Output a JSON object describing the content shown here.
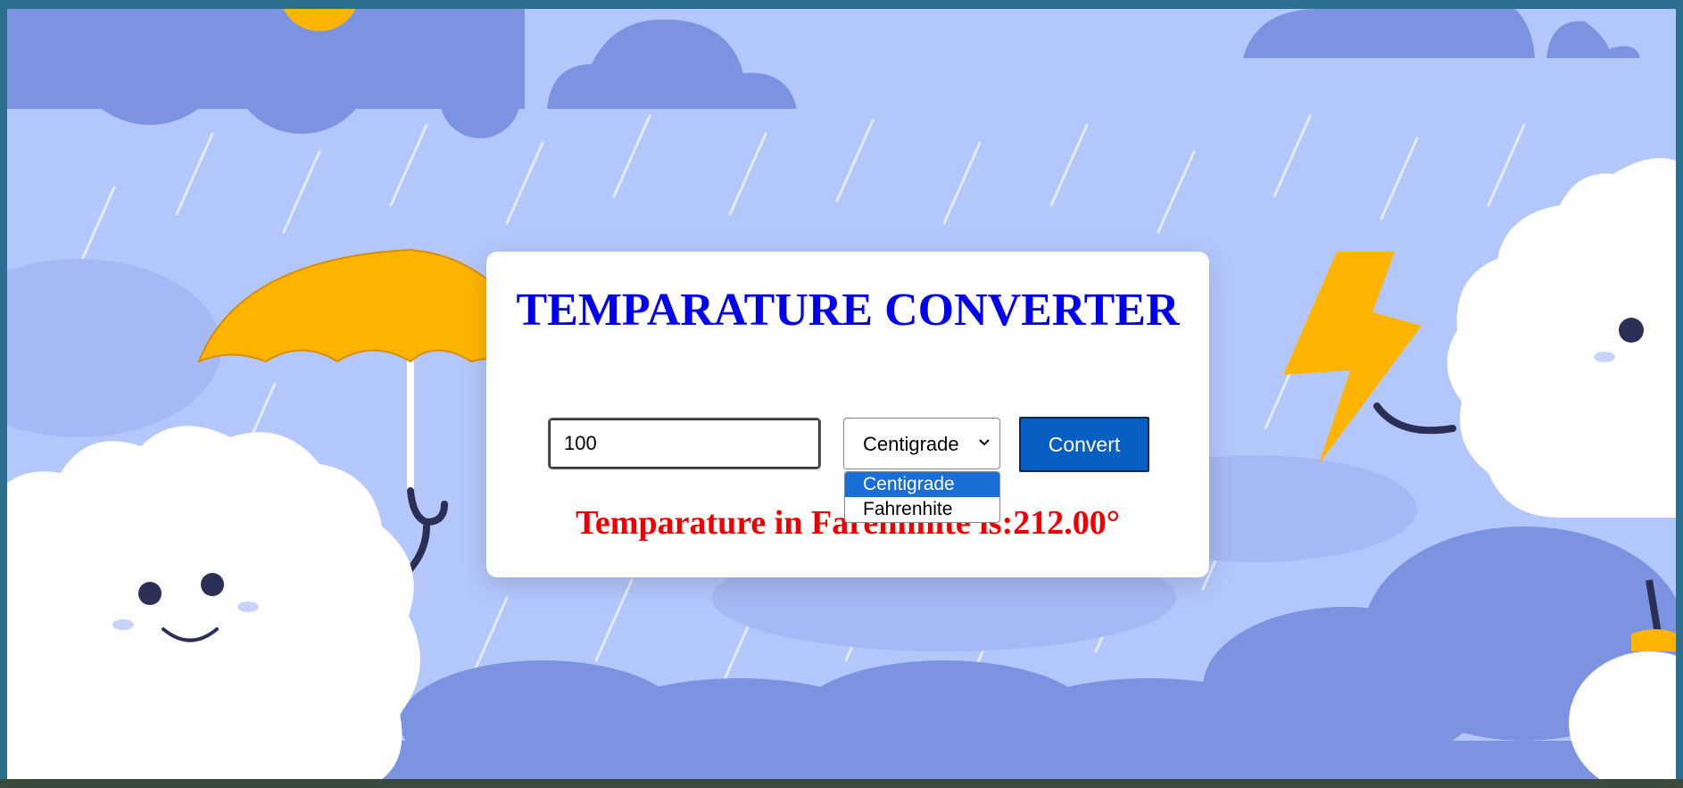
{
  "app": {
    "title": "TEMPARATURE CONVERTER"
  },
  "form": {
    "input_value": "100",
    "selected_unit": "Centigrade",
    "unit_options": [
      "Centigrade",
      "Fahrenhite"
    ],
    "convert_label": "Convert"
  },
  "result": {
    "text": "Temparature in Farenhhite is:212.00°"
  },
  "colors": {
    "title": "#0000ee",
    "result": "#ee0000",
    "button": "#075fc1",
    "background": "#b4c7fb",
    "cloud_dark": "#7b93e0",
    "accent": "#ffb400"
  }
}
